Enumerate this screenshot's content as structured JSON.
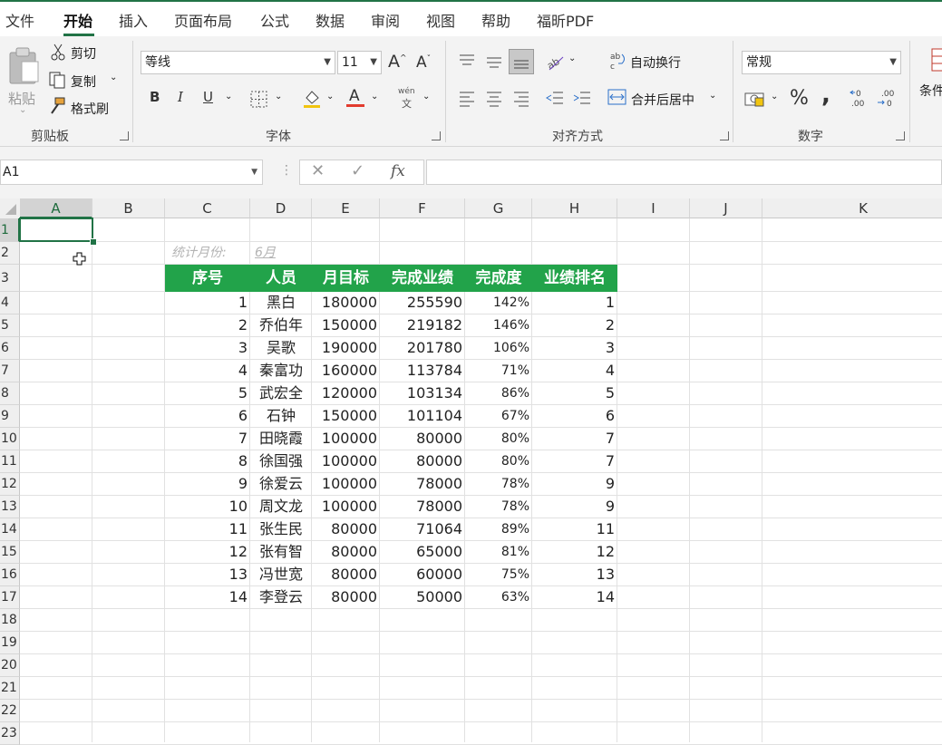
{
  "tabs": [
    "文件",
    "开始",
    "插入",
    "页面布局",
    "公式",
    "数据",
    "审阅",
    "视图",
    "帮助",
    "福昕PDF"
  ],
  "active_tab": "开始",
  "ribbon": {
    "clipboard": {
      "paste": "粘贴",
      "cut": "剪切",
      "copy": "复制",
      "format_painter": "格式刷",
      "label": "剪贴板"
    },
    "font": {
      "name": "等线",
      "size": "11",
      "grow": "A^",
      "shrink": "Aˇ",
      "bold": "B",
      "italic": "I",
      "underline": "U",
      "phonetic_top": "wén",
      "phonetic_bottom": "文",
      "label": "字体"
    },
    "alignment": {
      "wrap": "自动换行",
      "merge": "合并后居中",
      "label": "对齐方式"
    },
    "number": {
      "format": "常规",
      "percent": "%",
      "comma": ",",
      "label": "数字"
    },
    "styles": {
      "conditional": "条件"
    }
  },
  "name_box": "A1",
  "fx": "fx",
  "columns": [
    "A",
    "B",
    "C",
    "D",
    "E",
    "F",
    "G",
    "H",
    "I",
    "J",
    "K"
  ],
  "selected_column": "A",
  "rows": [
    "1",
    "2",
    "3",
    "4",
    "5",
    "6",
    "7",
    "8",
    "9",
    "10",
    "11",
    "12",
    "13",
    "14",
    "15",
    "16",
    "17",
    "18",
    "19",
    "20",
    "21",
    "22",
    "23"
  ],
  "selected_row": "1",
  "sheet": {
    "stat_label": "统计月份:",
    "stat_value": "6月",
    "headers": [
      "序号",
      "人员",
      "月目标",
      "完成业绩",
      "完成度",
      "业绩排名"
    ],
    "records": [
      [
        "1",
        "黑白",
        "180000",
        "255590",
        "142%",
        "1"
      ],
      [
        "2",
        "乔伯年",
        "150000",
        "219182",
        "146%",
        "2"
      ],
      [
        "3",
        "吴歌",
        "190000",
        "201780",
        "106%",
        "3"
      ],
      [
        "4",
        "秦富功",
        "160000",
        "113784",
        "71%",
        "4"
      ],
      [
        "5",
        "武宏全",
        "120000",
        "103134",
        "86%",
        "5"
      ],
      [
        "6",
        "石钟",
        "150000",
        "101104",
        "67%",
        "6"
      ],
      [
        "7",
        "田晓霞",
        "100000",
        "80000",
        "80%",
        "7"
      ],
      [
        "8",
        "徐国强",
        "100000",
        "80000",
        "80%",
        "7"
      ],
      [
        "9",
        "徐爱云",
        "100000",
        "78000",
        "78%",
        "9"
      ],
      [
        "10",
        "周文龙",
        "100000",
        "78000",
        "78%",
        "9"
      ],
      [
        "11",
        "张生民",
        "80000",
        "71064",
        "89%",
        "11"
      ],
      [
        "12",
        "张有智",
        "80000",
        "65000",
        "81%",
        "12"
      ],
      [
        "13",
        "冯世宽",
        "80000",
        "60000",
        "75%",
        "13"
      ],
      [
        "14",
        "李登云",
        "80000",
        "50000",
        "63%",
        "14"
      ]
    ]
  },
  "colors": {
    "accent": "#217346",
    "header_fill": "#22a34a"
  }
}
